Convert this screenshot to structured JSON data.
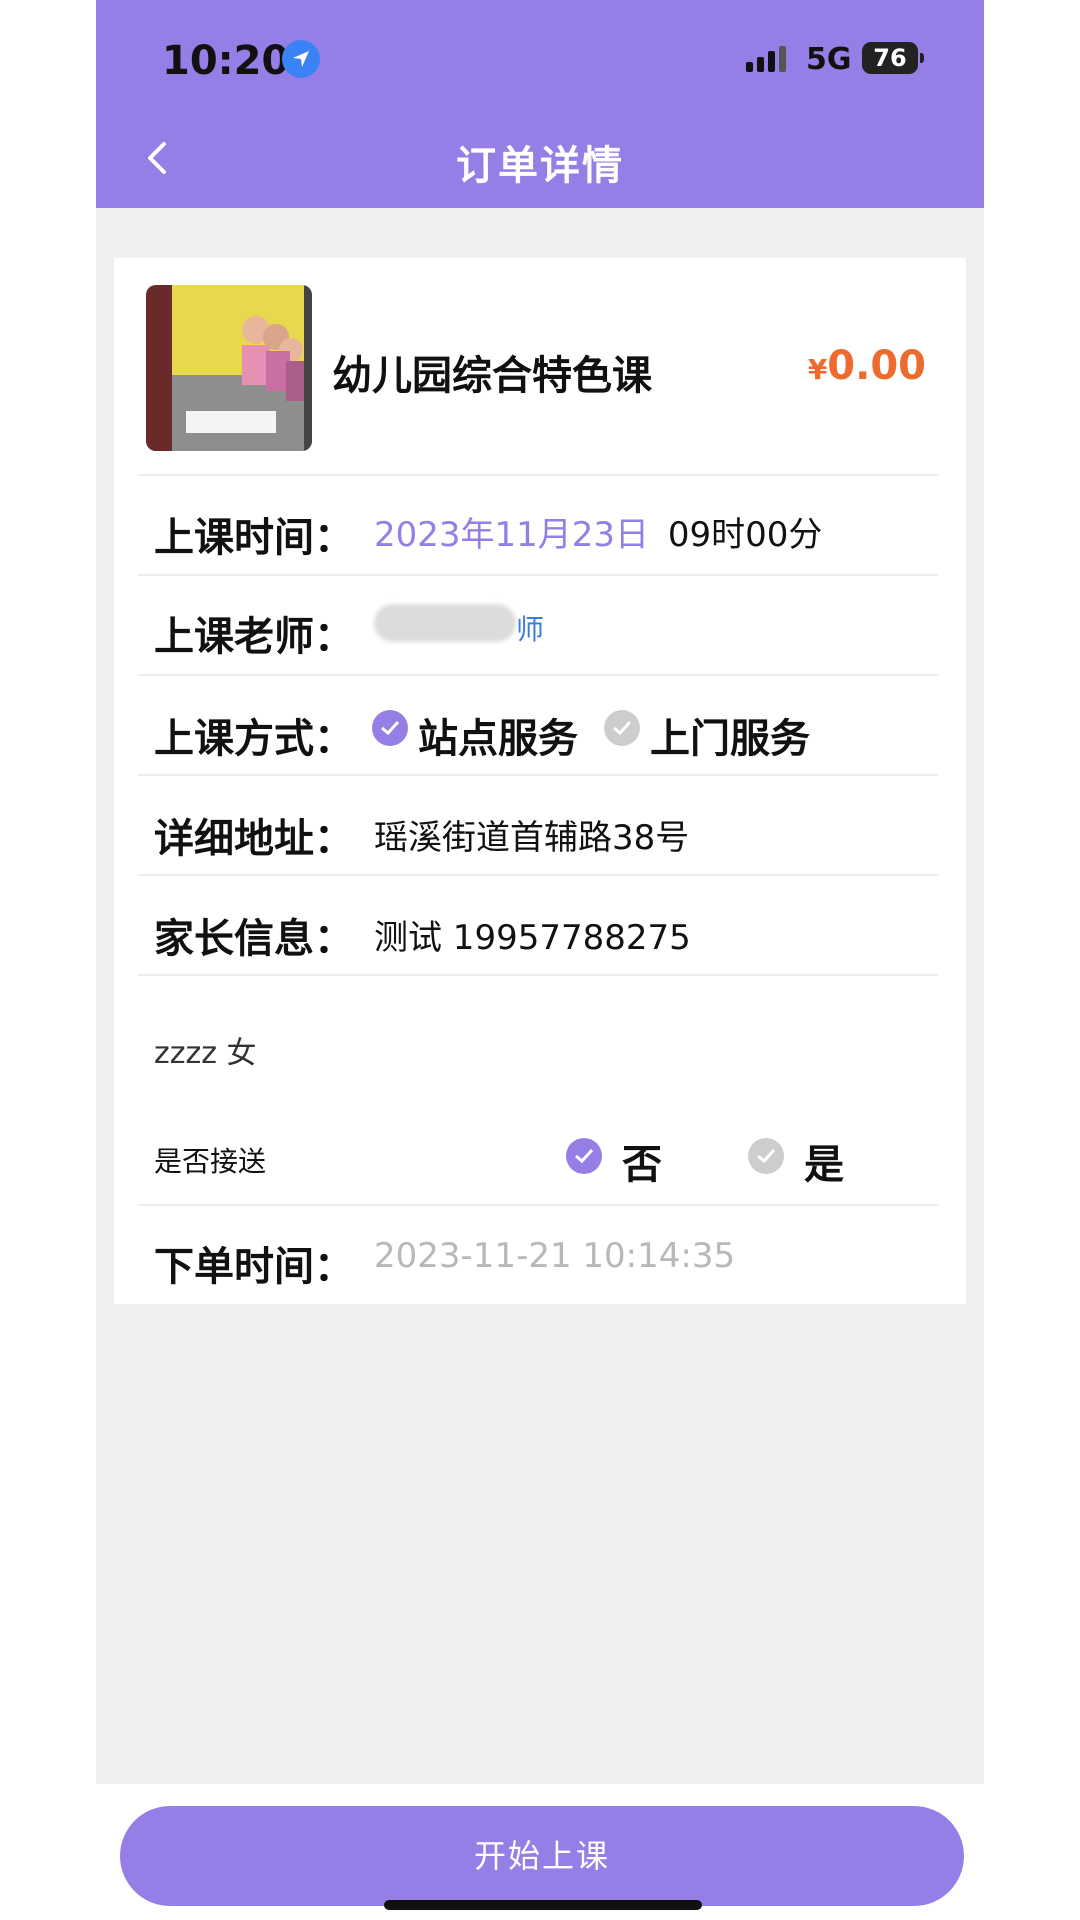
{
  "status_bar": {
    "time": "10:20",
    "network": "5G",
    "battery": "76"
  },
  "header": {
    "title": "订单详情"
  },
  "course": {
    "name": "幼儿园综合特色课",
    "price_symbol": "¥",
    "price": "0.00"
  },
  "rows": {
    "time_label": "上课时间：",
    "time_date": "2023年11月23日",
    "time_clock": "09时00分",
    "teacher_label": "上课老师：",
    "teacher_suffix": "师",
    "method_label": "上课方式：",
    "method_option_1": "站点服务",
    "method_option_2": "上门服务",
    "address_label": "详细地址：",
    "address_value": "瑶溪街道首辅路38号",
    "parent_label": "家长信息：",
    "parent_value": "测试 19957788275",
    "child_info": "zzzz 女",
    "pickup_label": "是否接送",
    "pickup_option_no": "否",
    "pickup_option_yes": "是",
    "order_time_label": "下单时间：",
    "order_time_value": "2023-11-21 10:14:35"
  },
  "actions": {
    "start_label": "开始上课"
  },
  "colors": {
    "primary": "#957fe6",
    "price": "#ee6b2f",
    "muted": "#b8b8b8"
  }
}
